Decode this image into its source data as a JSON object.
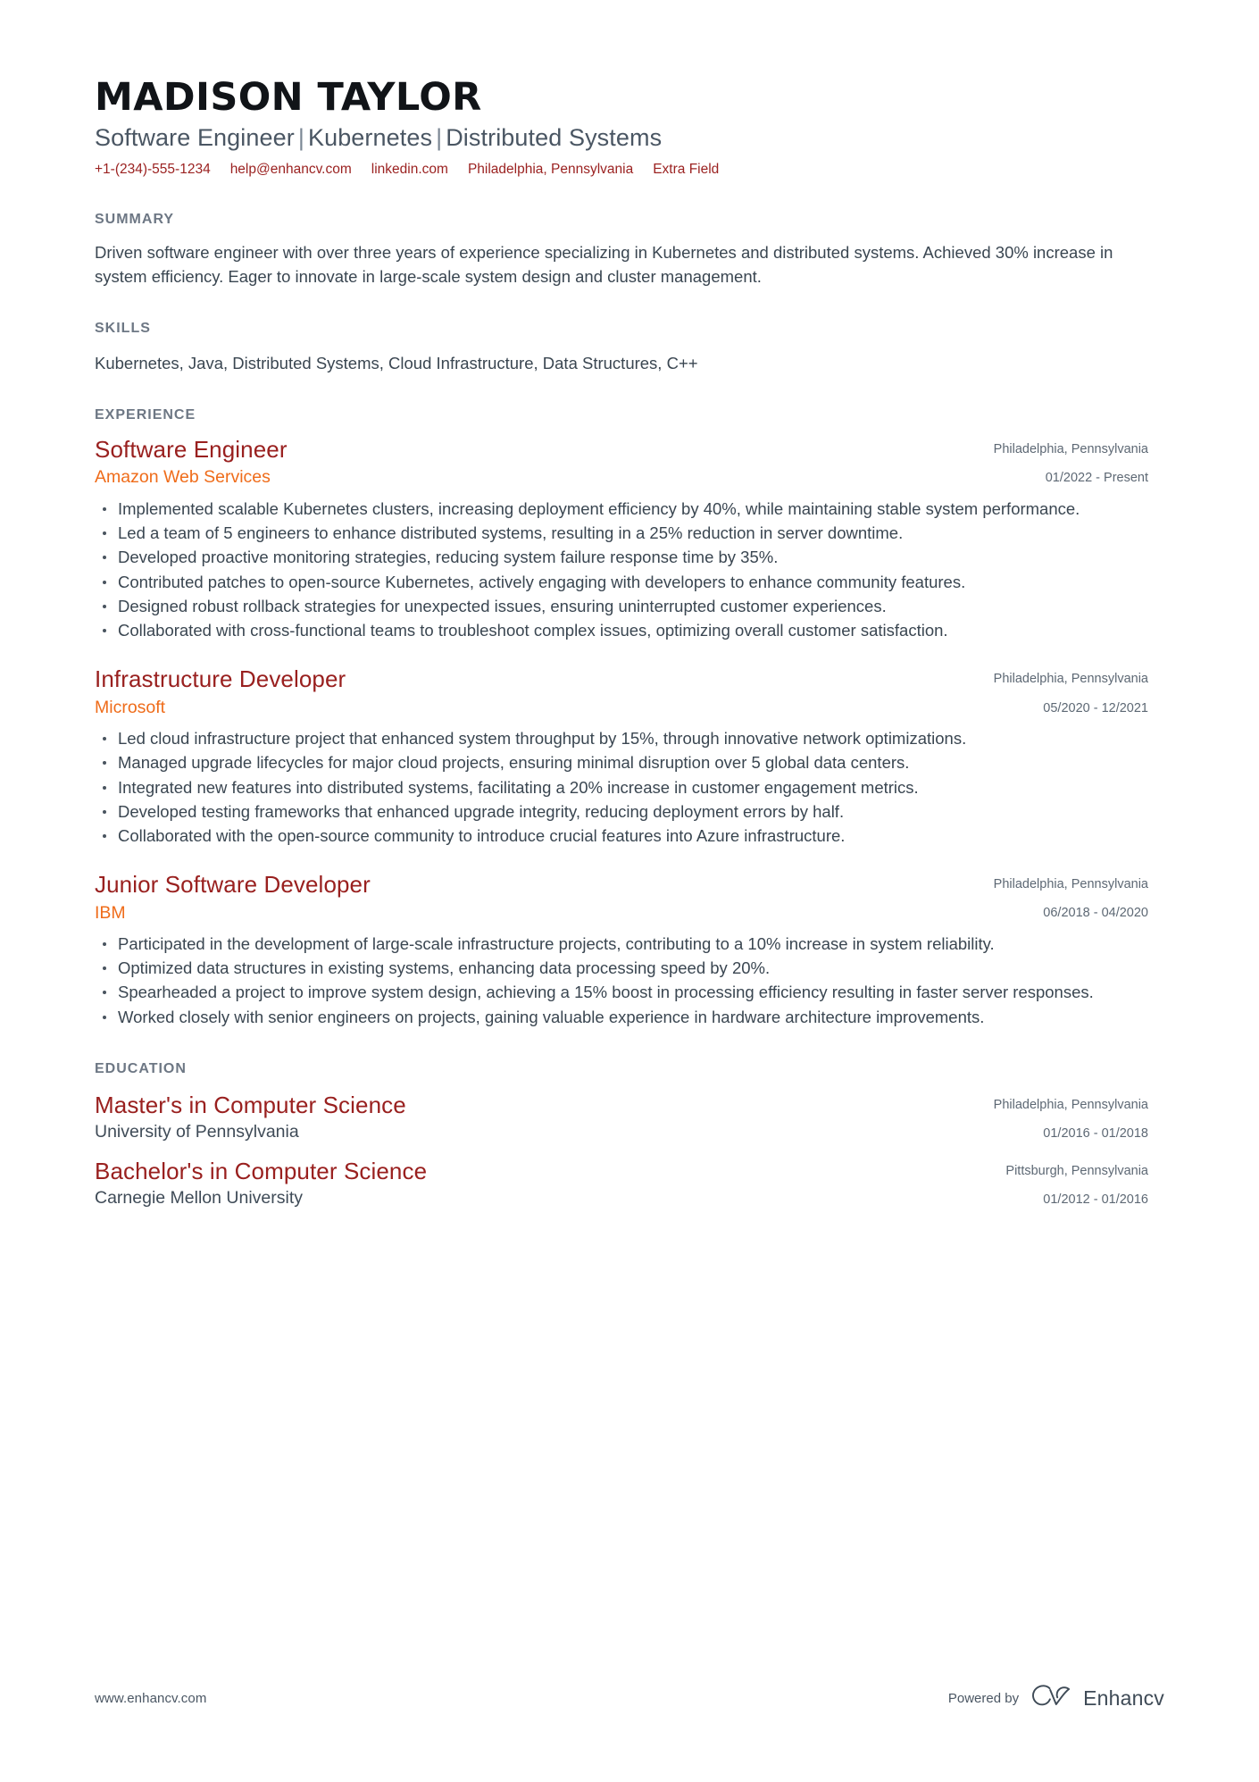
{
  "header": {
    "name": "MADISON TAYLOR",
    "headline_parts": [
      "Software Engineer",
      "Kubernetes",
      "Distributed Systems"
    ],
    "headline_separator": "|",
    "contacts": [
      {
        "name": "phone",
        "value": "+1-(234)-555-1234"
      },
      {
        "name": "email",
        "value": "help@enhancv.com"
      },
      {
        "name": "linkedin",
        "value": "linkedin.com"
      },
      {
        "name": "location",
        "value": "Philadelphia, Pennsylvania"
      },
      {
        "name": "extra",
        "value": "Extra Field"
      }
    ]
  },
  "sections": {
    "summary": {
      "title": "SUMMARY",
      "text": "Driven software engineer with over three years of experience specializing in Kubernetes and distributed systems. Achieved 30% increase in system efficiency. Eager to innovate in large-scale system design and cluster management."
    },
    "skills": {
      "title": "SKILLS",
      "text": "Kubernetes, Java, Distributed Systems, Cloud Infrastructure, Data Structures, C++"
    },
    "experience": {
      "title": "EXPERIENCE",
      "entries": [
        {
          "title": "Software Engineer",
          "company": "Amazon Web Services",
          "location": "Philadelphia, Pennsylvania",
          "dates": "01/2022 - Present",
          "bullets": [
            "Implemented scalable Kubernetes clusters, increasing deployment efficiency by 40%, while maintaining stable system performance.",
            "Led a team of 5 engineers to enhance distributed systems, resulting in a 25% reduction in server downtime.",
            "Developed proactive monitoring strategies, reducing system failure response time by 35%.",
            "Contributed patches to open-source Kubernetes, actively engaging with developers to enhance community features.",
            "Designed robust rollback strategies for unexpected issues, ensuring uninterrupted customer experiences.",
            "Collaborated with cross-functional teams to troubleshoot complex issues, optimizing overall customer satisfaction."
          ]
        },
        {
          "title": "Infrastructure Developer",
          "company": "Microsoft",
          "location": "Philadelphia, Pennsylvania",
          "dates": "05/2020 - 12/2021",
          "bullets": [
            "Led cloud infrastructure project that enhanced system throughput by 15%, through innovative network optimizations.",
            "Managed upgrade lifecycles for major cloud projects, ensuring minimal disruption over 5 global data centers.",
            "Integrated new features into distributed systems, facilitating a 20% increase in customer engagement metrics.",
            "Developed testing frameworks that enhanced upgrade integrity, reducing deployment errors by half.",
            "Collaborated with the open-source community to introduce crucial features into Azure infrastructure."
          ]
        },
        {
          "title": "Junior Software Developer",
          "company": "IBM",
          "location": "Philadelphia, Pennsylvania",
          "dates": "06/2018 - 04/2020",
          "bullets": [
            "Participated in the development of large-scale infrastructure projects, contributing to a 10% increase in system reliability.",
            "Optimized data structures in existing systems, enhancing data processing speed by 20%.",
            "Spearheaded a project to improve system design, achieving a 15% boost in processing efficiency resulting in faster server responses.",
            "Worked closely with senior engineers on projects, gaining valuable experience in hardware architecture improvements."
          ]
        }
      ]
    },
    "education": {
      "title": "EDUCATION",
      "entries": [
        {
          "degree": "Master's in Computer Science",
          "institution": "University of Pennsylvania",
          "location": "Philadelphia, Pennsylvania",
          "dates": "01/2016 - 01/2018"
        },
        {
          "degree": "Bachelor's in Computer Science",
          "institution": "Carnegie Mellon University",
          "location": "Pittsburgh, Pennsylvania",
          "dates": "01/2012 - 01/2016"
        }
      ]
    }
  },
  "footer": {
    "url": "www.enhancv.com",
    "powered_by": "Powered by",
    "brand": "Enhancv",
    "logo_icon": "enhancv-cv-mark-icon"
  },
  "colors": {
    "accent_title": "#99201f",
    "accent_company": "#ef6c1a",
    "contact_link": "#9b2221",
    "section_heading": "#6d7784",
    "body_text": "#3a4651"
  }
}
